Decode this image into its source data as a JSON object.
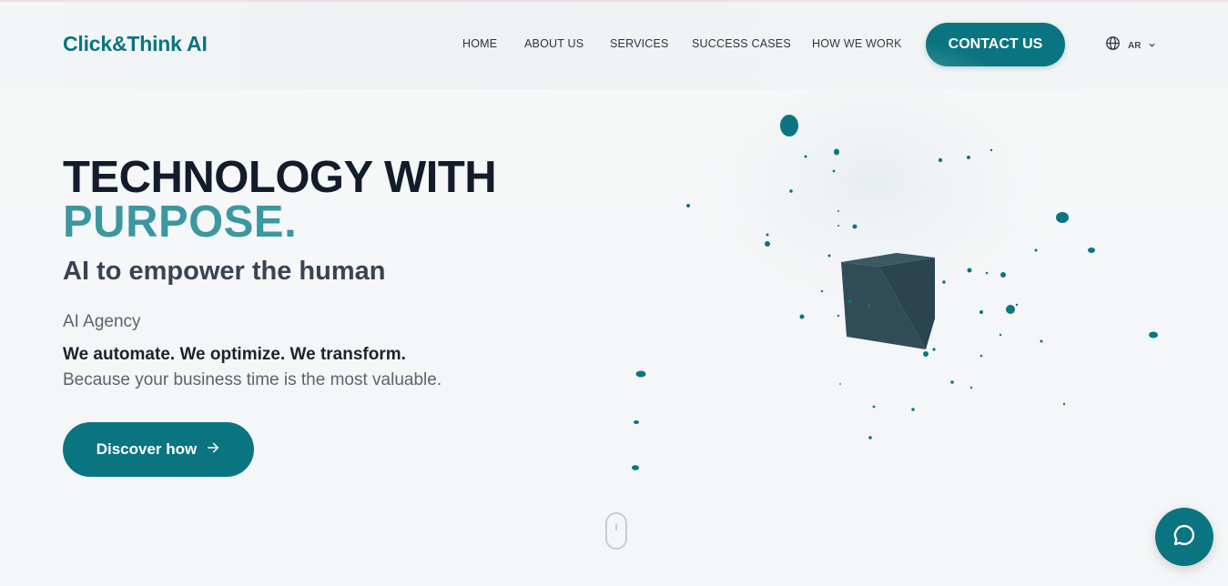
{
  "brand": {
    "name": "Click&Think AI",
    "accent_color": "#0a7580"
  },
  "nav": {
    "items": [
      "HOME",
      "ABOUT US",
      "SERVICES",
      "SUCCESS CASES",
      "HOW WE WORK"
    ],
    "cta_label": "CONTACT US",
    "language": {
      "code": "AR",
      "icon": "globe-icon",
      "chevron": "chevron-down-icon"
    }
  },
  "hero": {
    "title_line1": "TECHNOLOGY WITH",
    "title_line2": "PURPOSE.",
    "subtitle": "AI to empower the human",
    "kicker": "AI Agency",
    "tagline": "We automate. We optimize. We transform.",
    "description": "Because your business time is the most valuable.",
    "button_label": "Discover how",
    "button_icon": "arrow-right-icon"
  },
  "scroll_indicator": {
    "icon": "mouse-scroll-icon"
  },
  "chat": {
    "icon": "chat-bubble-icon"
  },
  "visual": {
    "description_icon": "particle-cube-icon",
    "particle_color": "#0a7580",
    "cube_color": "#2f4c57"
  }
}
